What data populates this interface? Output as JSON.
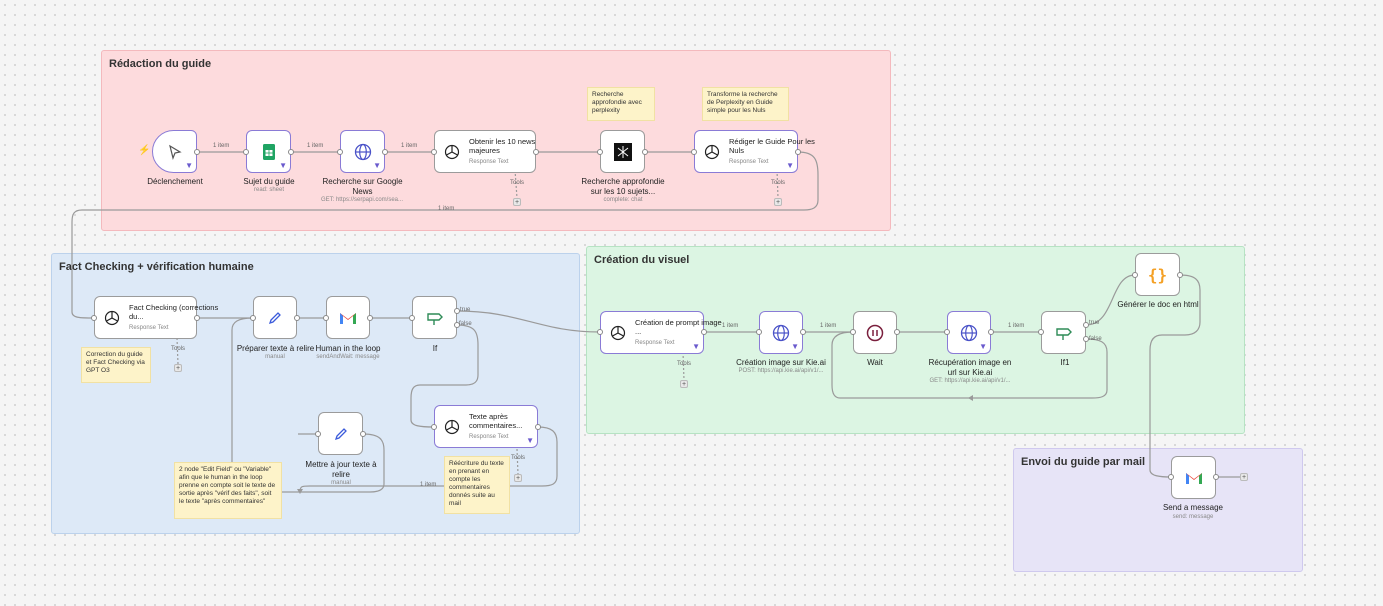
{
  "groups": {
    "redaction": "Rédaction du guide",
    "fact": "Fact Checking + vérification humaine",
    "visuel": "Création du visuel",
    "envoi": "Envoi du guide par mail"
  },
  "nodes": {
    "declenchement": {
      "label": "Déclenchement"
    },
    "sujet": {
      "label": "Sujet du guide",
      "sub": "read: sheet"
    },
    "recherche_google": {
      "label": "Recherche sur Google News",
      "sub": "GET: https://serpapi.com/sea..."
    },
    "obtenir_news": {
      "label": "Obtenir les 10 news majeures",
      "sub": "Response Text"
    },
    "recherche_perplexity": {
      "label": "Recherche approfondie sur les 10 sujets...",
      "sub": "complete: chat"
    },
    "rediger_guide": {
      "label": "Rédiger le Guide Pour les Nuls",
      "sub": "Response Text"
    },
    "fact_checking": {
      "label": "Fact Checking (corrections du...",
      "sub": "Response Text"
    },
    "preparer_texte": {
      "label": "Préparer texte à relire",
      "sub": "manual"
    },
    "human_loop": {
      "label": "Human in the loop",
      "sub": "sendAndWait: message"
    },
    "if": {
      "label": "If"
    },
    "texte_apres": {
      "label": "Texte après commentaires...",
      "sub": "Response Text"
    },
    "mettre_a_jour": {
      "label": "Mettre à jour texte à relire",
      "sub": "manual"
    },
    "creation_prompt": {
      "label": "Création de prompt image ...",
      "sub": "Response Text"
    },
    "creation_image": {
      "label": "Création image sur Kie.ai",
      "sub": "POST: https://api.kie.ai/api/v1/..."
    },
    "wait": {
      "label": "Wait"
    },
    "recuperation_image": {
      "label": "Récupération image en url sur Kie.ai",
      "sub": "GET: https://api.kie.ai/api/v1/..."
    },
    "if1": {
      "label": "If1"
    },
    "generer_doc": {
      "label": "Générer le doc en html"
    },
    "send_message": {
      "label": "Send a message",
      "sub": "send: message"
    }
  },
  "notes": {
    "perplexity": "Recherche approfondie avec perplexity",
    "transforme": "Transforme la recherche de Perplexity en Guide simple pour les Nuls",
    "correction": "Correction du guide et Fact Checking via GPT O3",
    "edit_field": "2 node \"Edit Field\" ou \"Variable\" afin que le human in the loop prenne en compte soit le texte de sortie après \"vérif des faits\", soit le texte \"après commentaires\"",
    "reecriture": "Réécriture du texte en prenant en compte les commentaires donnés suite au mail"
  },
  "edge_labels": {
    "one_item": "1 item",
    "tools": "Tools",
    "true": "true",
    "false": "false"
  },
  "icons": {
    "cursor": "cursor-icon",
    "sheets": "google-sheets-icon",
    "globe": "globe-icon",
    "openai": "openai-icon",
    "perplexity": "perplexity-icon",
    "pen": "pen-icon",
    "gmail": "gmail-icon",
    "if": "if-signpost-icon",
    "pause": "pause-icon",
    "code": "code-braces-icon"
  },
  "colors": {
    "accent": "#6a5acd",
    "trigger": "#f28a5b",
    "globe": "#4a52c8",
    "if": "#2e8b57",
    "code": "#f4a025"
  }
}
